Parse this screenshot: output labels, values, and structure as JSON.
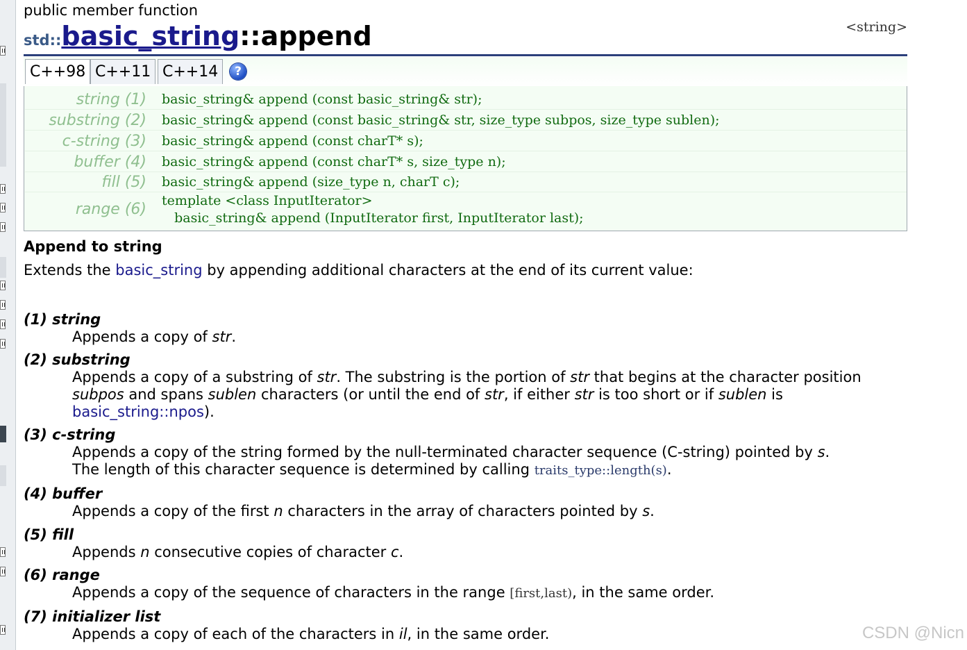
{
  "page": {
    "kind_label": "public member function",
    "namespace": "std::",
    "class_name": "basic_string",
    "separator": "::",
    "function_name": "append",
    "header": "<string>"
  },
  "tabs": [
    {
      "label": "C++98",
      "active": true
    },
    {
      "label": "C++11",
      "active": false
    },
    {
      "label": "C++14",
      "active": false
    }
  ],
  "help_icon": "?",
  "prototypes": [
    {
      "label": "string (1)",
      "code": "basic_string& append (const basic_string& str);"
    },
    {
      "label": "substring (2)",
      "code": "basic_string& append (const basic_string& str, size_type subpos, size_type sublen);"
    },
    {
      "label": "c-string (3)",
      "code": "basic_string& append (const charT* s);"
    },
    {
      "label": "buffer (4)",
      "code": "basic_string& append (const charT* s, size_type n);"
    },
    {
      "label": "fill (5)",
      "code": "basic_string& append (size_type n, charT c);"
    },
    {
      "label": "range (6)",
      "code": "template <class InputIterator>\n   basic_string& append (InputIterator first, InputIterator last);"
    }
  ],
  "section_title": "Append to string",
  "intro": {
    "before": "Extends the ",
    "link": "basic_string",
    "after": " by appending additional characters at the end of its current value:"
  },
  "items": {
    "i1": {
      "title": "(1) string",
      "t1": "Appends a copy of ",
      "e1": "str",
      "t2": "."
    },
    "i2": {
      "title": "(2) substring",
      "t1": "Appends a copy of a substring of ",
      "e1": "str",
      "t2": ". The substring is the portion of ",
      "e2": "str",
      "t3": " that begins at the character position ",
      "e3": "subpos",
      "t4": " and spans ",
      "e4": "sublen",
      "t5": " characters (or until the end of ",
      "e5": "str",
      "t6": ", if either ",
      "e6": "str",
      "t7": " is too short or if ",
      "e7": "sublen",
      "t8": " is ",
      "link": "basic_string::npos",
      "t9": ")."
    },
    "i3": {
      "title": "(3) c-string",
      "t1": "Appends a copy of the string formed by the null-terminated character sequence (C-string) pointed by ",
      "e1": "s",
      "t2": ".",
      "t3": "The length of this character sequence is determined by calling ",
      "code": "traits_type::length(s)",
      "t4": "."
    },
    "i4": {
      "title": "(4) buffer",
      "t1": "Appends a copy of the first ",
      "e1": "n",
      "t2": " characters in the array of characters pointed by ",
      "e2": "s",
      "t3": "."
    },
    "i5": {
      "title": "(5) fill",
      "t1": "Appends ",
      "e1": "n",
      "t2": " consecutive copies of character ",
      "e2": "c",
      "t3": "."
    },
    "i6": {
      "title": "(6) range",
      "t1": "Appends a copy of the sequence of characters in the range ",
      "code": "[first,last)",
      "t2": ", in the same order."
    },
    "i7": {
      "title": "(7) initializer list",
      "t1": "Appends a copy of each of the characters in ",
      "e1": "il",
      "t2": ", in the same order."
    }
  },
  "watermark": "CSDN @Nicn",
  "colors": {
    "link": "#1a1a8c",
    "title_rule": "#2b3f7a",
    "proto_bg": "#f4fdf4",
    "proto_code": "#106a10",
    "proto_label": "#8fbf8f"
  }
}
